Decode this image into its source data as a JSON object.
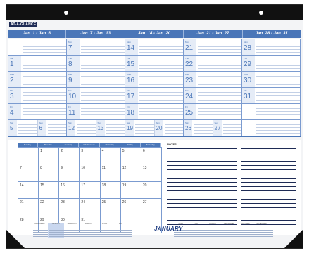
{
  "brand": "AT-A-GLANCE",
  "weeks": [
    "Jan. 1 - Jan. 6",
    "Jan. 7 - Jan. 13",
    "Jan. 14 - Jan. 20",
    "Jan. 21 - Jan. 27",
    "Jan. 28 - Jan. 31"
  ],
  "rows": [
    {
      "name": "Mon",
      "days": [
        "",
        "7",
        "14",
        "21",
        "28"
      ]
    },
    {
      "name": "Tue",
      "days": [
        "1",
        "8",
        "15",
        "22",
        "29"
      ]
    },
    {
      "name": "Wed",
      "days": [
        "2",
        "9",
        "16",
        "23",
        "30"
      ]
    },
    {
      "name": "Thu",
      "days": [
        "3",
        "10",
        "17",
        "24",
        "31"
      ]
    },
    {
      "name": "Fri",
      "days": [
        "4",
        "11",
        "18",
        "25",
        ""
      ]
    }
  ],
  "weekend": {
    "sat_label": "Sat",
    "sun_label": "Sun",
    "days": [
      [
        "5",
        "6"
      ],
      [
        "12",
        "13"
      ],
      [
        "19",
        "20"
      ],
      [
        "26",
        "27"
      ],
      [
        "",
        ""
      ]
    ]
  },
  "month_headers": [
    "Sunday",
    "Monday",
    "Tuesday",
    "Wednesday",
    "Thursday",
    "Friday",
    "Saturday"
  ],
  "month_cells": [
    "",
    "1",
    "2",
    "3",
    "4",
    "5",
    "6",
    "7",
    "8",
    "9",
    "10",
    "11",
    "12",
    "13",
    "14",
    "15",
    "16",
    "17",
    "18",
    "19",
    "20",
    "21",
    "22",
    "23",
    "24",
    "25",
    "26",
    "27",
    "28",
    "29",
    "30",
    "31",
    "",
    "",
    ""
  ],
  "notes_label": "NOTES",
  "month_title": "JANUARY",
  "mini_months": [
    "DECEMBER",
    "JANUARY",
    "FEBRUARY",
    "MARCH",
    "APRIL",
    "MAY",
    "JUNE",
    "JULY",
    "AUGUST",
    "SEPTEMBER",
    "OCTOBER",
    "NOVEMBER"
  ],
  "highlight_month_index": 1,
  "colors": {
    "accent": "#4a76b8",
    "dark_band": "#111111",
    "notes_lines": "#1e2b55"
  }
}
